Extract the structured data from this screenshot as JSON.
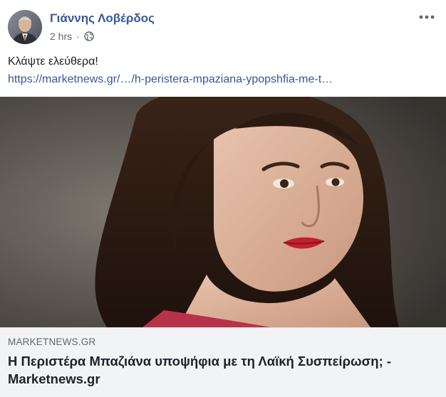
{
  "post": {
    "author": "Γιάννης Λοβέρδος",
    "time": "2 hrs",
    "separator": "·",
    "privacy_icon": "globe-icon",
    "more_icon": "more-options-icon",
    "text": "Κλάψτε ελεύθερα!",
    "link_text": "https://marketnews.gr/…/h-peristera-mpaziana-ypopshfia-me-t…"
  },
  "link_card": {
    "domain": "MARKETNEWS.GR",
    "headline": "Η Περιστέρα Μπαζιάνα υποψήφια με τη Λαϊκή Συσπείρωση; - Marketnews.gr"
  },
  "colors": {
    "author_blue": "#385898",
    "link_blue": "#385898",
    "card_bg": "#f2f3f5",
    "meta_gray": "#616770"
  }
}
